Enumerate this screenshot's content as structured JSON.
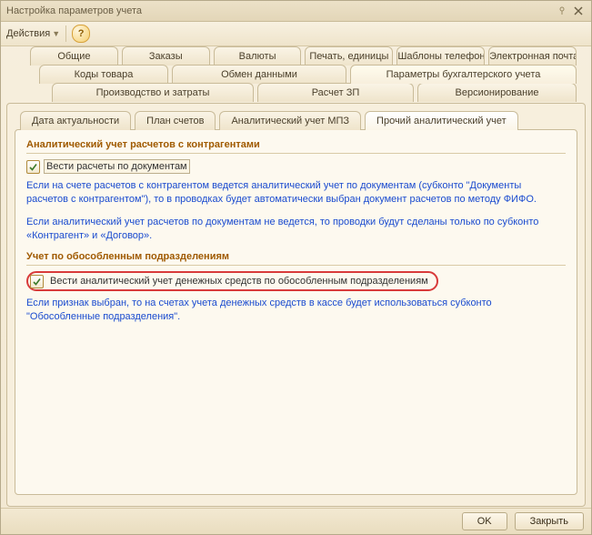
{
  "window": {
    "title": "Настройка параметров учета"
  },
  "toolbar": {
    "actions_label": "Действия"
  },
  "tabs_row1": [
    "Общие",
    "Заказы",
    "Валюты",
    "Печать, единицы",
    "Шаблоны телефонов",
    "Электронная почта"
  ],
  "tabs_row2": [
    "Коды товара",
    "Обмен данными",
    "Параметры бухгалтерского учета"
  ],
  "tabs_row3": [
    "Производство и затраты",
    "Расчет ЗП",
    "Версионирование"
  ],
  "subtabs": [
    "Дата актуальности",
    "План счетов",
    "Аналитический учет МПЗ",
    "Прочий аналитический учет"
  ],
  "section1": {
    "title": "Аналитический учет расчетов с контрагентами",
    "checkbox_label": "Вести расчеты по документам",
    "hint1": "Если на счете расчетов с контрагентом ведется аналитический учет по документам (субконто \"Документы расчетов с контрагентом\"), то в проводках будет автоматически выбран  документ расчетов по методу ФИФО.",
    "hint2": "Если аналитический учет расчетов по документам не ведется, то проводки будут сделаны только по субконто «Контрагент» и «Договор»."
  },
  "section2": {
    "title": "Учет по обособленным подразделениям",
    "checkbox_label": "Вести аналитический учет денежных средств по обособленным подразделениям",
    "hint": "Если признак выбран, то на счетах учета денежных средств в кассе будет использоваться субконто \"Обособленные подразделения\"."
  },
  "footer": {
    "ok": "OK",
    "close": "Закрыть"
  }
}
